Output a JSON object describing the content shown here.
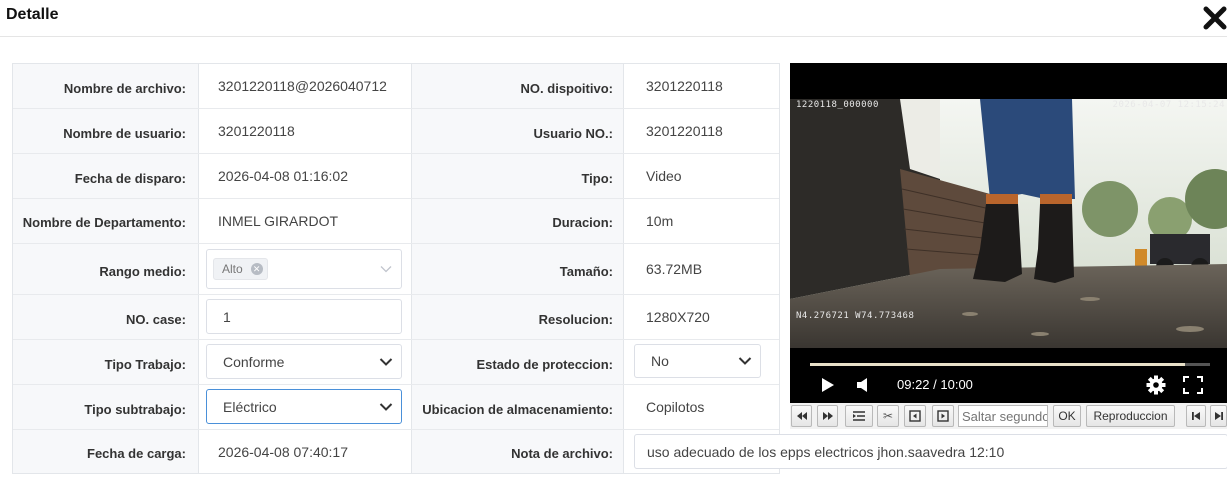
{
  "dialog": {
    "title": "Detalle"
  },
  "left_fields": {
    "nombre_archivo": {
      "label": "Nombre de archivo:",
      "value": "3201220118@2026040712"
    },
    "nombre_usuario": {
      "label": "Nombre de usuario:",
      "value": "3201220118"
    },
    "fecha_disparo": {
      "label": "Fecha de disparo:",
      "value": "2026-04-08 01:16:02"
    },
    "departamento": {
      "label": "Nombre de Departamento:",
      "value": "INMEL GIRARDOT"
    },
    "rango_medio": {
      "label": "Rango medio:",
      "tag": "Alto"
    },
    "no_case": {
      "label": "NO. case:",
      "value": "1"
    },
    "tipo_trabajo": {
      "label": "Tipo Trabajo:",
      "selected": "Conforme"
    },
    "tipo_subtrabajo": {
      "label": "Tipo subtrabajo:",
      "selected": "Eléctrico"
    },
    "fecha_carga": {
      "label": "Fecha de carga:",
      "value": "2026-04-08 07:40:17"
    }
  },
  "right_fields": {
    "no_dispositivo": {
      "label": "NO. dispoitivo:",
      "value": "3201220118"
    },
    "usuario_no": {
      "label": "Usuario NO.:",
      "value": "3201220118"
    },
    "tipo": {
      "label": "Tipo:",
      "value": "Video"
    },
    "duracion": {
      "label": "Duracion:",
      "value": "10m"
    },
    "tamano": {
      "label": "Tamaño:",
      "value": "63.72MB"
    },
    "resolucion": {
      "label": "Resolucion:",
      "value": "1280X720"
    },
    "estado_proteccion": {
      "label": "Estado de proteccion:",
      "selected": "No"
    },
    "ubicacion": {
      "label": "Ubicacion de almacenamiento:",
      "value": "Copilotos"
    },
    "nota_archivo": {
      "label": "Nota de archivo:",
      "value": "uso adecuado de los epps electricos jhon.saavedra 12:10"
    }
  },
  "player": {
    "osd_top_left": "1220118_000000",
    "osd_top_right": "2026-04-07 12:15:24",
    "osd_bottom_left": "N4.276721 W74.773468",
    "time": "09:22 / 10:00",
    "progress_fraction": 0.937,
    "colors": {
      "progress": "#e8e0c8",
      "background": "#000000"
    }
  },
  "controls": {
    "rewind_icon": "rewind-icon",
    "fast_forward_icon": "fast-forward-icon",
    "seek_placeholder": "Saltar segundos",
    "ok_label": "OK",
    "playback_label": "Reproduccion"
  },
  "colors": {
    "label_bg": "#f7f8fa",
    "border": "#e3e6ea",
    "focus": "#4a90d9"
  }
}
